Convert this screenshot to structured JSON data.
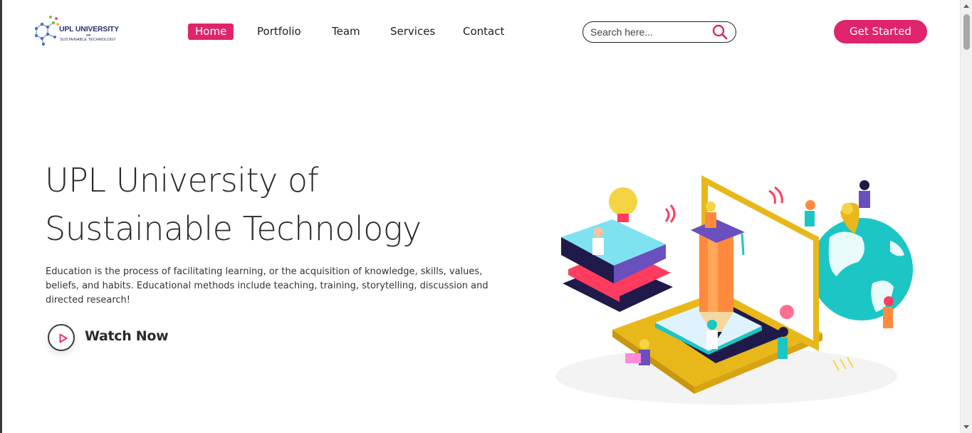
{
  "brand": {
    "title": "UPL UNIVERSITY",
    "of": "OF",
    "subtitle": "SUSTAINABLE TECHNOLOGY"
  },
  "nav": {
    "items": [
      {
        "label": "Home",
        "active": true
      },
      {
        "label": "Portfolio",
        "active": false
      },
      {
        "label": "Team",
        "active": false
      },
      {
        "label": "Services",
        "active": false
      },
      {
        "label": "Contact",
        "active": false
      }
    ]
  },
  "search": {
    "placeholder": "Search here...",
    "value": "",
    "icon": "search-icon"
  },
  "cta": {
    "label": "Get Started"
  },
  "hero": {
    "title_line1": "UPL University of",
    "title_line2": "Sustainable Technology",
    "description_line1": "Education is the process of facilitating learning, or the acquisition of knowledge, skills, values,",
    "description_line2": "beliefs, and habits. Educational methods include teaching, training, storytelling, discussion and",
    "description_line3": "directed research!",
    "watch_label": "Watch Now",
    "play_icon": "play-icon"
  },
  "colors": {
    "accent": "#e0246c",
    "text_dark": "#2b2b2b",
    "logo_blue": "#26326e",
    "illustration_yellow": "#e8b81a",
    "illustration_teal": "#1cc6c4",
    "illustration_navy": "#1f1a4a"
  }
}
